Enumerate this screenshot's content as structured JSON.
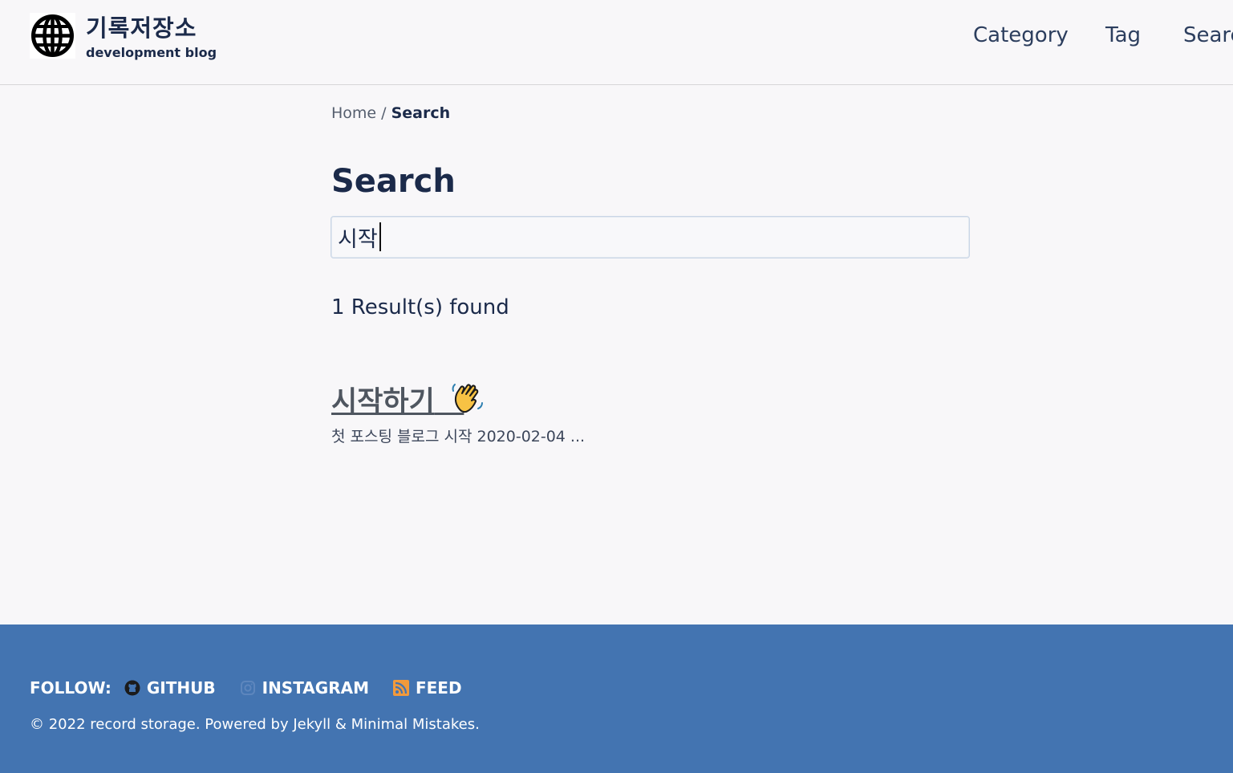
{
  "header": {
    "site_title": "기록저장소",
    "site_subtitle": "development blog",
    "logo_icon": "globe-icon",
    "nav": [
      "Category",
      "Tag",
      "Search"
    ]
  },
  "breadcrumb": {
    "home": "Home",
    "separator": " / ",
    "current": "Search"
  },
  "main": {
    "title": "Search",
    "search_value": "시작",
    "results_count": "1 Result(s) found",
    "results": [
      {
        "title": "시작하기",
        "emoji_icon": "waving-hand-icon",
        "excerpt": "첫 포스팅 블로그 시작 2020-02-04 ..."
      }
    ]
  },
  "footer": {
    "follow_label": "FOLLOW:",
    "links": [
      {
        "label": "GITHUB",
        "icon": "github-icon"
      },
      {
        "label": "INSTAGRAM",
        "icon": "instagram-icon"
      },
      {
        "label": "FEED",
        "icon": "rss-icon"
      }
    ],
    "copyright": "© 2022 record storage. Powered by Jekyll & Minimal Mistakes."
  },
  "colors": {
    "background": "#f8f7f9",
    "text": "#1b2a4a",
    "footer": "#4374b1",
    "rss": "#f29a3c"
  }
}
